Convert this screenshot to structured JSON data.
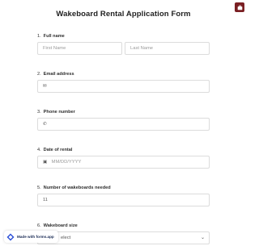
{
  "form": {
    "title": "Wakeboard Rental Application Form"
  },
  "questions": [
    {
      "number": "1.",
      "label": "Full name",
      "first_placeholder": "First Name",
      "last_placeholder": "Last Name"
    },
    {
      "number": "2.",
      "label": "Email address",
      "icon": "envelope-icon",
      "glyph": "✉"
    },
    {
      "number": "3.",
      "label": "Phone number",
      "icon": "phone-icon",
      "glyph": "✆"
    },
    {
      "number": "4.",
      "label": "Date of rental",
      "icon": "calendar-icon",
      "glyph": "▣",
      "placeholder": "MM/DD/YYYY"
    },
    {
      "number": "5.",
      "label": "Number of wakeboards needed",
      "icon": "number-icon",
      "glyph": "11"
    },
    {
      "number": "6.",
      "label": "Wakeboard size",
      "value": "Select",
      "visible_value": "elect"
    }
  ],
  "badge": {
    "text": "Made with forms.app"
  },
  "colors": {
    "accent": "#7a1f23",
    "border": "#dcdcdc"
  }
}
